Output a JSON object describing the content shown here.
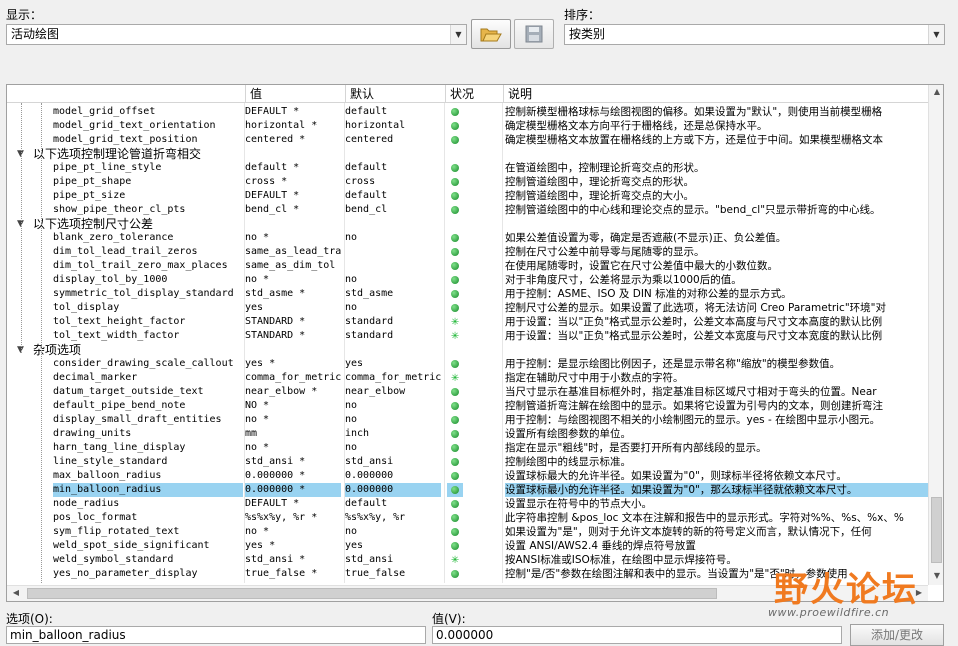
{
  "top": {
    "display_label": "显示：",
    "display_value": "活动绘图",
    "sort_label": "排序：",
    "sort_value": "按类别"
  },
  "grid": {
    "headers": {
      "value": "值",
      "default": "默认",
      "status": "状况",
      "description": "说明"
    },
    "rows": [
      {
        "type": "item",
        "name": "model_grid_offset",
        "value": "DEFAULT *",
        "default": "default",
        "status": "dot",
        "desc": "控制新模型栅格球标与绘图视图的偏移。如果设置为\"默认\"，则使用当前模型栅格"
      },
      {
        "type": "item",
        "name": "model_grid_text_orientation",
        "value": "horizontal *",
        "default": "horizontal",
        "status": "dot",
        "desc": "确定模型栅格文本方向平行于栅格线，还是总保持水平。"
      },
      {
        "type": "item",
        "name": "model_grid_text_position",
        "value": "centered *",
        "default": "centered",
        "status": "dot",
        "desc": "确定模型栅格文本放置在栅格线的上方或下方，还是位于中间。如果模型栅格文本"
      },
      {
        "type": "section",
        "name": "以下选项控制理论管道折弯相交"
      },
      {
        "type": "item",
        "name": "pipe_pt_line_style",
        "value": "default *",
        "default": "default",
        "status": "dot",
        "desc": "在管道绘图中，控制理论折弯交点的形状。"
      },
      {
        "type": "item",
        "name": "pipe_pt_shape",
        "value": "cross *",
        "default": "cross",
        "status": "dot",
        "desc": "控制管道绘图中，理论折弯交点的形状。"
      },
      {
        "type": "item",
        "name": "pipe_pt_size",
        "value": "DEFAULT *",
        "default": "default",
        "status": "dot",
        "desc": "控制管道绘图中，理论折弯交点的大小。"
      },
      {
        "type": "item",
        "name": "show_pipe_theor_cl_pts",
        "value": "bend_cl *",
        "default": "bend_cl",
        "status": "dot",
        "desc": "控制管道绘图中的中心线和理论交点的显示。\"bend_cl\"只显示带折弯的中心线。"
      },
      {
        "type": "section",
        "name": "以下选项控制尺寸公差"
      },
      {
        "type": "item",
        "name": "blank_zero_tolerance",
        "value": "no *",
        "default": "no",
        "status": "dot",
        "desc": "如果公差值设置为零，确定是否遮蔽(不显示)正、负公差值。"
      },
      {
        "type": "item",
        "name": "dim_tol_lead_trail_zeros",
        "value": "same_as_lead_tra",
        "default": "",
        "status": "dot",
        "desc": "控制在尺寸公差中前导零与尾随零的显示。"
      },
      {
        "type": "item",
        "name": "dim_tol_trail_zero_max_places",
        "value": "same_as_dim_tol",
        "default": "",
        "status": "dot",
        "desc": "在使用尾随零时，设置它在尺寸公差值中最大的小数位数。"
      },
      {
        "type": "item",
        "name": "display_tol_by_1000",
        "value": "no *",
        "default": "no",
        "status": "dot",
        "desc": "对于非角度尺寸，公差将显示为乘以1000后的值。"
      },
      {
        "type": "item",
        "name": "symmetric_tol_display_standard",
        "value": "std_asme *",
        "default": "std_asme",
        "status": "dot",
        "desc": "用于控制：ASME、ISO 及 DIN 标准的对称公差的显示方式。"
      },
      {
        "type": "item",
        "name": "tol_display",
        "value": "yes",
        "default": "no",
        "status": "dot",
        "desc": "控制尺寸公差的显示。如果设置了此选项，将无法访问 Creo Parametric\"环境\"对"
      },
      {
        "type": "item",
        "name": "tol_text_height_factor",
        "value": "STANDARD *",
        "default": "standard",
        "status": "star",
        "desc": "用于设置：当以\"正负\"格式显示公差时，公差文本高度与尺寸文本高度的默认比例"
      },
      {
        "type": "item",
        "name": "tol_text_width_factor",
        "value": "STANDARD *",
        "default": "standard",
        "status": "star",
        "desc": "用于设置：当以\"正负\"格式显示公差时，公差文本宽度与尺寸文本宽度的默认比例"
      },
      {
        "type": "section",
        "name": "杂项选项"
      },
      {
        "type": "item",
        "name": "consider_drawing_scale_callout",
        "value": "yes *",
        "default": "yes",
        "status": "dot",
        "desc": "用于控制：是显示绘图比例因子，还是显示带名称\"缩放\"的模型参数值。"
      },
      {
        "type": "item",
        "name": "decimal_marker",
        "value": "comma_for_metric",
        "default": "comma_for_metric",
        "status": "star",
        "desc": "指定在辅助尺寸中用于小数点的字符。"
      },
      {
        "type": "item",
        "name": "datum_target_outside_text",
        "value": "near_elbow *",
        "default": "near_elbow",
        "status": "dot",
        "desc": "当尺寸显示在基准目标框外时，指定基准目标区域尺寸相对于弯头的位置。Near"
      },
      {
        "type": "item",
        "name": "default_pipe_bend_note",
        "value": "NO *",
        "default": "no",
        "status": "dot",
        "desc": "控制管道折弯注解在绘图中的显示。如果将它设置为引号内的文本，则创建折弯注"
      },
      {
        "type": "item",
        "name": "display_small_draft_entities",
        "value": "no *",
        "default": "no",
        "status": "dot",
        "desc": "用于控制：与绘图视图不相关的小绘制图元的显示。yes - 在绘图中显示小图元。"
      },
      {
        "type": "item",
        "name": "drawing_units",
        "value": "mm",
        "default": "inch",
        "status": "dot",
        "desc": "设置所有绘图参数的单位。"
      },
      {
        "type": "item",
        "name": "harn_tang_line_display",
        "value": "no *",
        "default": "no",
        "status": "dot",
        "desc": "指定在显示\"粗线\"时，是否要打开所有内部线段的显示。"
      },
      {
        "type": "item",
        "name": "line_style_standard",
        "value": "std_ansi *",
        "default": "std_ansi",
        "status": "dot",
        "desc": "控制绘图中的线显示标准。"
      },
      {
        "type": "item",
        "name": "max_balloon_radius",
        "value": "0.000000 *",
        "default": "0.000000",
        "status": "dot",
        "desc": "设置球标最大的允许半径。如果设置为\"0\"，则球标半径将依赖文本尺寸。"
      },
      {
        "type": "item",
        "name": "min_balloon_radius",
        "value": "0.000000 *",
        "default": "0.000000",
        "status": "dot",
        "desc": "设置球标最小的允许半径。如果设置为\"0\"，那么球标半径就依赖文本尺寸。",
        "selected": true
      },
      {
        "type": "item",
        "name": "node_radius",
        "value": "DEFAULT *",
        "default": "default",
        "status": "dot",
        "desc": "设置显示在符号中的节点大小。"
      },
      {
        "type": "item",
        "name": "pos_loc_format",
        "value": "%s%x%y, %r *",
        "default": "%s%x%y, %r",
        "status": "dot",
        "desc": "此字符串控制 &pos_loc 文本在注解和报告中的显示形式。字符对%%、%s、%x、%"
      },
      {
        "type": "item",
        "name": "sym_flip_rotated_text",
        "value": "no *",
        "default": "no",
        "status": "dot",
        "desc": "如果设置为\"是\"，则对于允许文本旋转的新的符号定义而言，默认情况下，任何"
      },
      {
        "type": "item",
        "name": "weld_spot_side_significant",
        "value": "yes *",
        "default": "yes",
        "status": "dot",
        "desc": "设置 ANSI/AWS2.4 垂线的焊点符号放置"
      },
      {
        "type": "item",
        "name": "weld_symbol_standard",
        "value": "std_ansi *",
        "default": "std_ansi",
        "status": "star",
        "desc": "按ANSI标准或ISO标准，在绘图中显示焊接符号。"
      },
      {
        "type": "item",
        "name": "yes_no_parameter_display",
        "value": "true_false *",
        "default": "true_false",
        "status": "dot",
        "desc": "控制\"是/否\"参数在绘图注解和表中的显示。当设置为\"是\"否\"时，参数使用"
      }
    ]
  },
  "bottom": {
    "option_label": "选项(O):",
    "option_value": "min_balloon_radius",
    "value_label": "值(V):",
    "value_value": "0.000000",
    "add_button": "添加/更改"
  },
  "watermark": {
    "brand": "野火论坛",
    "url": "www.proewildfire.cn"
  },
  "icons": {
    "open": "folder-open-icon",
    "save": "save-disk-icon"
  }
}
